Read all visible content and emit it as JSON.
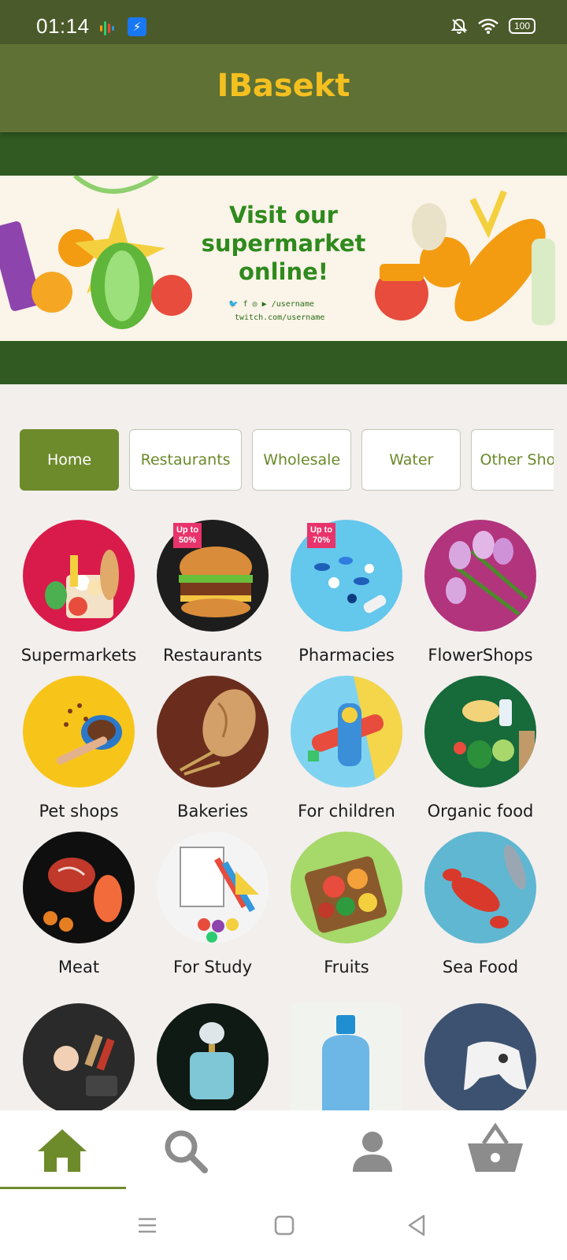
{
  "status_bar": {
    "time": "01:14",
    "battery": "100",
    "icons": [
      "dots-icon",
      "usb-icon",
      "bell-off-icon",
      "wifi-icon",
      "battery-icon"
    ]
  },
  "header": {
    "title": "IBasekt"
  },
  "banner": {
    "headline_line1": "Visit our",
    "headline_line2": "supermarket",
    "headline_line3": "online!",
    "social_handle": "/username",
    "url": "twitch.com/username"
  },
  "tabs": [
    {
      "label": "Home",
      "active": true
    },
    {
      "label": "Restaurants",
      "active": false
    },
    {
      "label": "Wholesale",
      "active": false
    },
    {
      "label": "Water",
      "active": false
    },
    {
      "label": "Other Shops",
      "active": false
    }
  ],
  "categories": [
    {
      "label": "Supermarkets"
    },
    {
      "label": "Restaurants",
      "badge": "Up to 50%"
    },
    {
      "label": "Pharmacies",
      "badge": "Up to 70%"
    },
    {
      "label": "FlowerShops"
    },
    {
      "label": "Pet shops"
    },
    {
      "label": "Bakeries"
    },
    {
      "label": "For children"
    },
    {
      "label": "Organic food"
    },
    {
      "label": "Meat"
    },
    {
      "label": "For Study"
    },
    {
      "label": "Fruits"
    },
    {
      "label": "Sea Food"
    }
  ],
  "bottom_nav": {
    "items": [
      "home-icon",
      "search-icon",
      "profile-icon",
      "basket-icon"
    ],
    "active": "home-icon"
  },
  "colors": {
    "primary": "#6e8b2c",
    "header": "#5f7134",
    "title": "#f4c020",
    "banner_text": "#2f8a1e"
  }
}
